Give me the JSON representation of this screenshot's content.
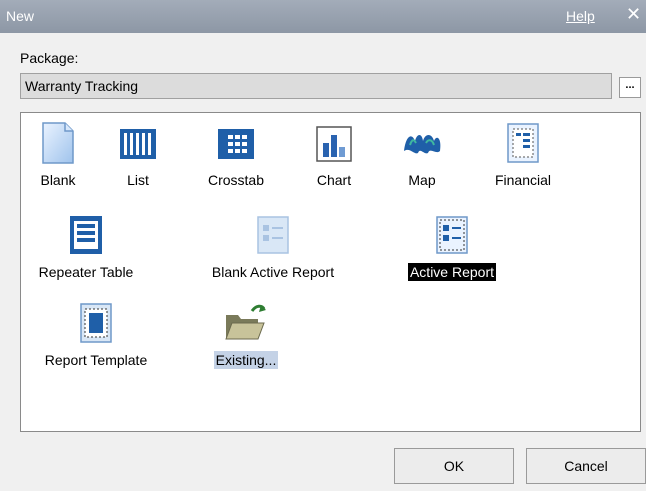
{
  "window": {
    "title": "New",
    "help_label": "Help",
    "close_glyph": "✕"
  },
  "package": {
    "label": "Package:",
    "value": "Warranty Tracking",
    "browse_label": "..."
  },
  "gallery": {
    "items": [
      {
        "label": "Blank",
        "icon": "blank-page-icon",
        "selected": false
      },
      {
        "label": "List",
        "icon": "list-icon",
        "selected": false
      },
      {
        "label": "Crosstab",
        "icon": "crosstab-icon",
        "selected": false
      },
      {
        "label": "Chart",
        "icon": "chart-icon",
        "selected": false
      },
      {
        "label": "Map",
        "icon": "map-icon",
        "selected": false
      },
      {
        "label": "Financial",
        "icon": "financial-icon",
        "selected": false
      },
      {
        "label": "Repeater Table",
        "icon": "repeater-table-icon",
        "selected": false
      },
      {
        "label": "Blank Active Report",
        "icon": "blank-active-report-icon",
        "selected": false
      },
      {
        "label": "Active Report",
        "icon": "active-report-icon",
        "selected": true
      },
      {
        "label": "Report Template",
        "icon": "report-template-icon",
        "selected": false
      },
      {
        "label": "Existing...",
        "icon": "open-folder-icon",
        "selected": false
      }
    ]
  },
  "buttons": {
    "ok_label": "OK",
    "cancel_label": "Cancel"
  },
  "colors": {
    "titlebar": "#9ba5b3",
    "selection": "#000000",
    "icon_blue": "#1f5fa8"
  }
}
